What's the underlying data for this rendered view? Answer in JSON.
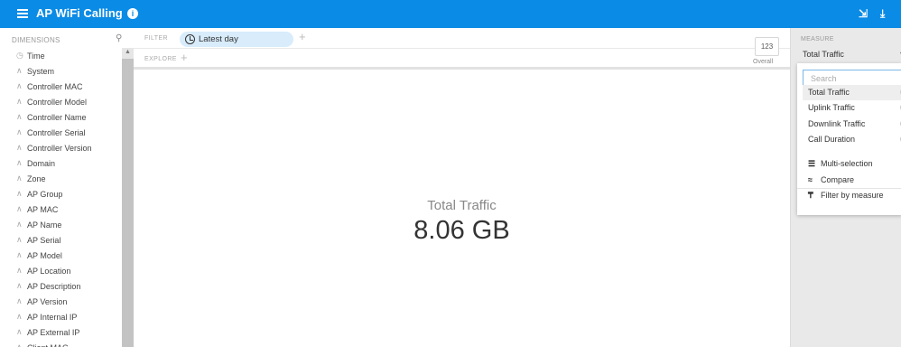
{
  "app": {
    "title": "AP WiFi Calling",
    "icons": [
      "menu-icon",
      "info-icon",
      "pin-icon",
      "download-icon"
    ]
  },
  "dimensions": {
    "header": "DIMENSIONS",
    "items": [
      {
        "label": "Time",
        "icon": "clock-icon"
      },
      {
        "label": "System",
        "icon": "string-dimension-icon"
      },
      {
        "label": "Controller MAC",
        "icon": "string-dimension-icon"
      },
      {
        "label": "Controller Model",
        "icon": "string-dimension-icon"
      },
      {
        "label": "Controller Name",
        "icon": "string-dimension-icon"
      },
      {
        "label": "Controller Serial",
        "icon": "string-dimension-icon"
      },
      {
        "label": "Controller Version",
        "icon": "string-dimension-icon"
      },
      {
        "label": "Domain",
        "icon": "string-dimension-icon"
      },
      {
        "label": "Zone",
        "icon": "string-dimension-icon"
      },
      {
        "label": "AP Group",
        "icon": "string-dimension-icon"
      },
      {
        "label": "AP MAC",
        "icon": "string-dimension-icon"
      },
      {
        "label": "AP Name",
        "icon": "string-dimension-icon"
      },
      {
        "label": "AP Serial",
        "icon": "string-dimension-icon"
      },
      {
        "label": "AP Model",
        "icon": "string-dimension-icon"
      },
      {
        "label": "AP Location",
        "icon": "string-dimension-icon"
      },
      {
        "label": "AP Description",
        "icon": "string-dimension-icon"
      },
      {
        "label": "AP Version",
        "icon": "string-dimension-icon"
      },
      {
        "label": "AP Internal IP",
        "icon": "string-dimension-icon"
      },
      {
        "label": "AP External IP",
        "icon": "string-dimension-icon"
      },
      {
        "label": "Client MAC",
        "icon": "string-dimension-icon"
      }
    ]
  },
  "filter": {
    "label": "FILTER",
    "pill": "Latest day"
  },
  "explore": {
    "label": "EXPLORE"
  },
  "overall": {
    "value": "123",
    "label": "Overall"
  },
  "main": {
    "measure_label": "Total Traffic",
    "measure_value": "8.06 GB"
  },
  "measure_panel": {
    "header": "MEASURE",
    "selected": "Total Traffic",
    "search_placeholder": "Search",
    "options": [
      "Total Traffic",
      "Uplink Traffic",
      "Downlink Traffic",
      "Call Duration"
    ],
    "actions": [
      {
        "label": "Multi-selection",
        "icon": "list-icon"
      },
      {
        "label": "Compare",
        "icon": "compare-icon"
      },
      {
        "label": "Filter by measure",
        "icon": "filter-by-measure-icon"
      }
    ]
  }
}
